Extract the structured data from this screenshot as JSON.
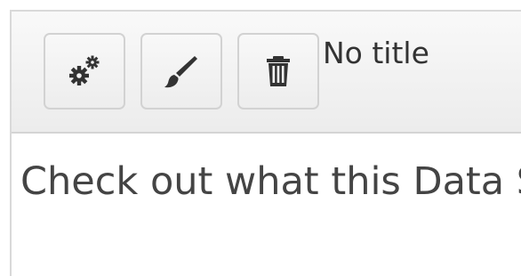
{
  "panel": {
    "title": "No title",
    "body_text": "Check out what this Data Story",
    "toolbar": [
      {
        "icon": "gears-icon",
        "action": "settings"
      },
      {
        "icon": "brush-icon",
        "action": "edit-style"
      },
      {
        "icon": "trash-icon",
        "action": "delete"
      }
    ]
  },
  "colors": {
    "icon": "#333333",
    "text": "#444444",
    "header_bg": "#f0f0f0",
    "border": "#d9d9d9"
  }
}
